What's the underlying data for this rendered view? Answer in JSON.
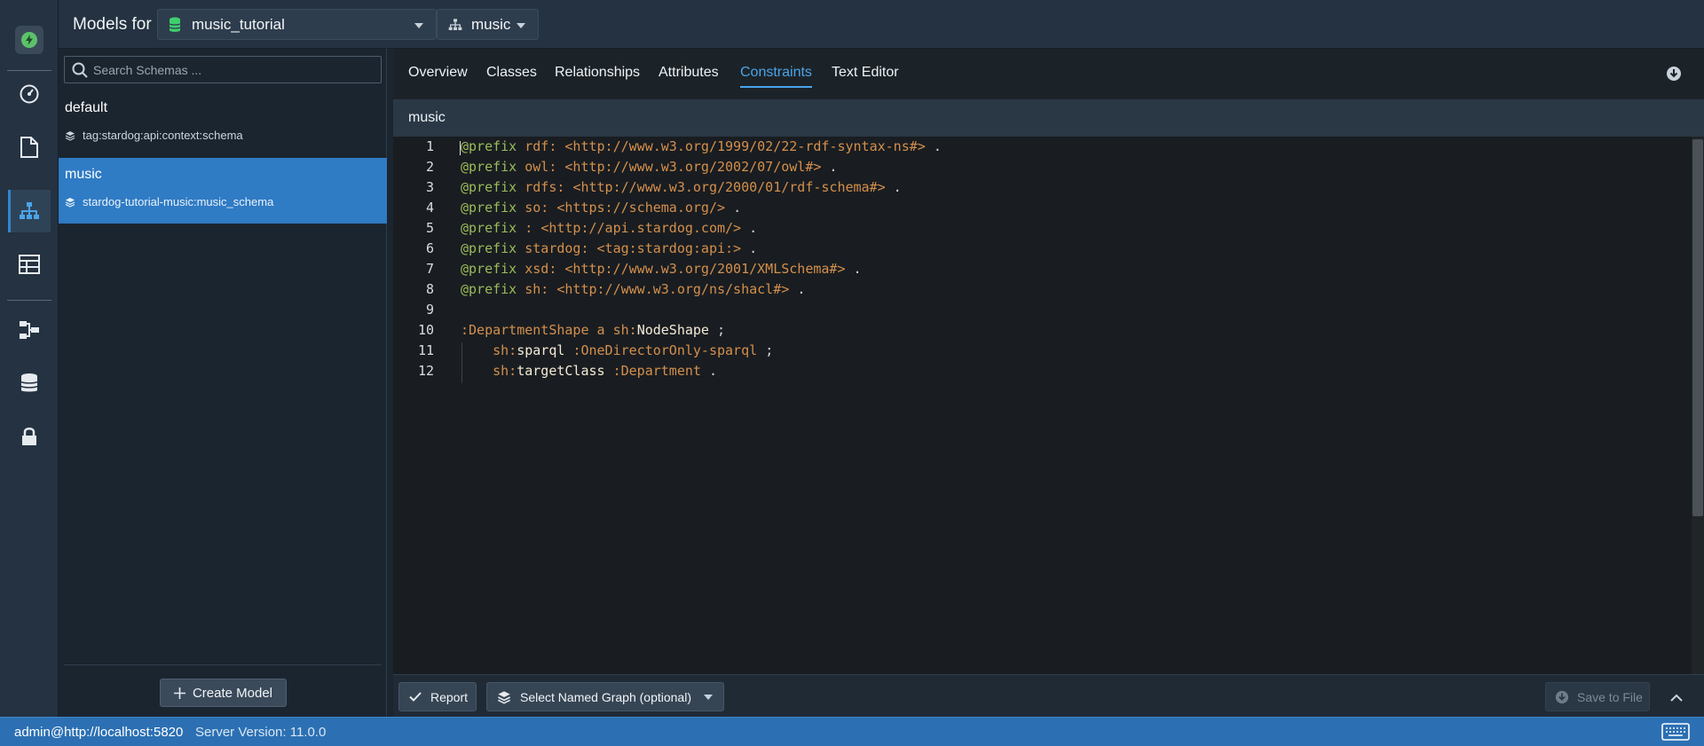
{
  "header": {
    "title": "Models for",
    "database": "music_tutorial",
    "model": "music"
  },
  "sidebar": {
    "search_placeholder": "Search Schemas ...",
    "groups": [
      {
        "name": "default",
        "item": "tag:stardog:api:context:schema"
      },
      {
        "name": "music",
        "item": "stardog-tutorial-music:music_schema"
      }
    ],
    "create_label": "Create Model"
  },
  "tabs": [
    "Overview",
    "Classes",
    "Relationships",
    "Attributes",
    "Constraints",
    "Text Editor"
  ],
  "active_tab": "Constraints",
  "subheader": "music",
  "editor": {
    "line_numbers": [
      "1",
      "2",
      "3",
      "4",
      "5",
      "6",
      "7",
      "8",
      "9",
      "10",
      "11",
      "12"
    ],
    "lines": [
      {
        "kw": "@prefix",
        "pfx": "rdf:",
        "iri": "<http://www.w3.org/1999/02/22-rdf-syntax-ns#>",
        "end": "."
      },
      {
        "kw": "@prefix",
        "pfx": "owl:",
        "iri": "<http://www.w3.org/2002/07/owl#>",
        "end": "."
      },
      {
        "kw": "@prefix",
        "pfx": "rdfs:",
        "iri": "<http://www.w3.org/2000/01/rdf-schema#>",
        "end": "."
      },
      {
        "kw": "@prefix",
        "pfx": "so:",
        "iri": "<https://schema.org/>",
        "end": "."
      },
      {
        "kw": "@prefix",
        "pfx": ":",
        "iri": "<http://api.stardog.com/>",
        "end": "."
      },
      {
        "kw": "@prefix",
        "pfx": "stardog:",
        "iri": "<tag:stardog:api:>",
        "end": "."
      },
      {
        "kw": "@prefix",
        "pfx": "xsd:",
        "iri": "<http://www.w3.org/2001/XMLSchema#>",
        "end": "."
      },
      {
        "kw": "@prefix",
        "pfx": "sh:",
        "iri": "<http://www.w3.org/ns/shacl#>",
        "end": "."
      }
    ],
    "line10": {
      "subject": ":DepartmentShape",
      "a": "a",
      "type_pfx": "sh:",
      "type_local": "NodeShape",
      "end": ";"
    },
    "line11": {
      "pred_pfx": "sh:",
      "pred_local": "sparql",
      "obj": ":OneDirectorOnly-sparql",
      "end": ";"
    },
    "line12": {
      "pred_pfx": "sh:",
      "pred_local": "targetClass",
      "obj": ":Department",
      "end": "."
    }
  },
  "footer": {
    "report_label": "Report",
    "named_graph_label": "Select Named Graph (optional)",
    "save_label": "Save to File"
  },
  "status": {
    "connection": "admin@http://localhost:5820",
    "server_version": "Server Version: 11.0.0"
  }
}
